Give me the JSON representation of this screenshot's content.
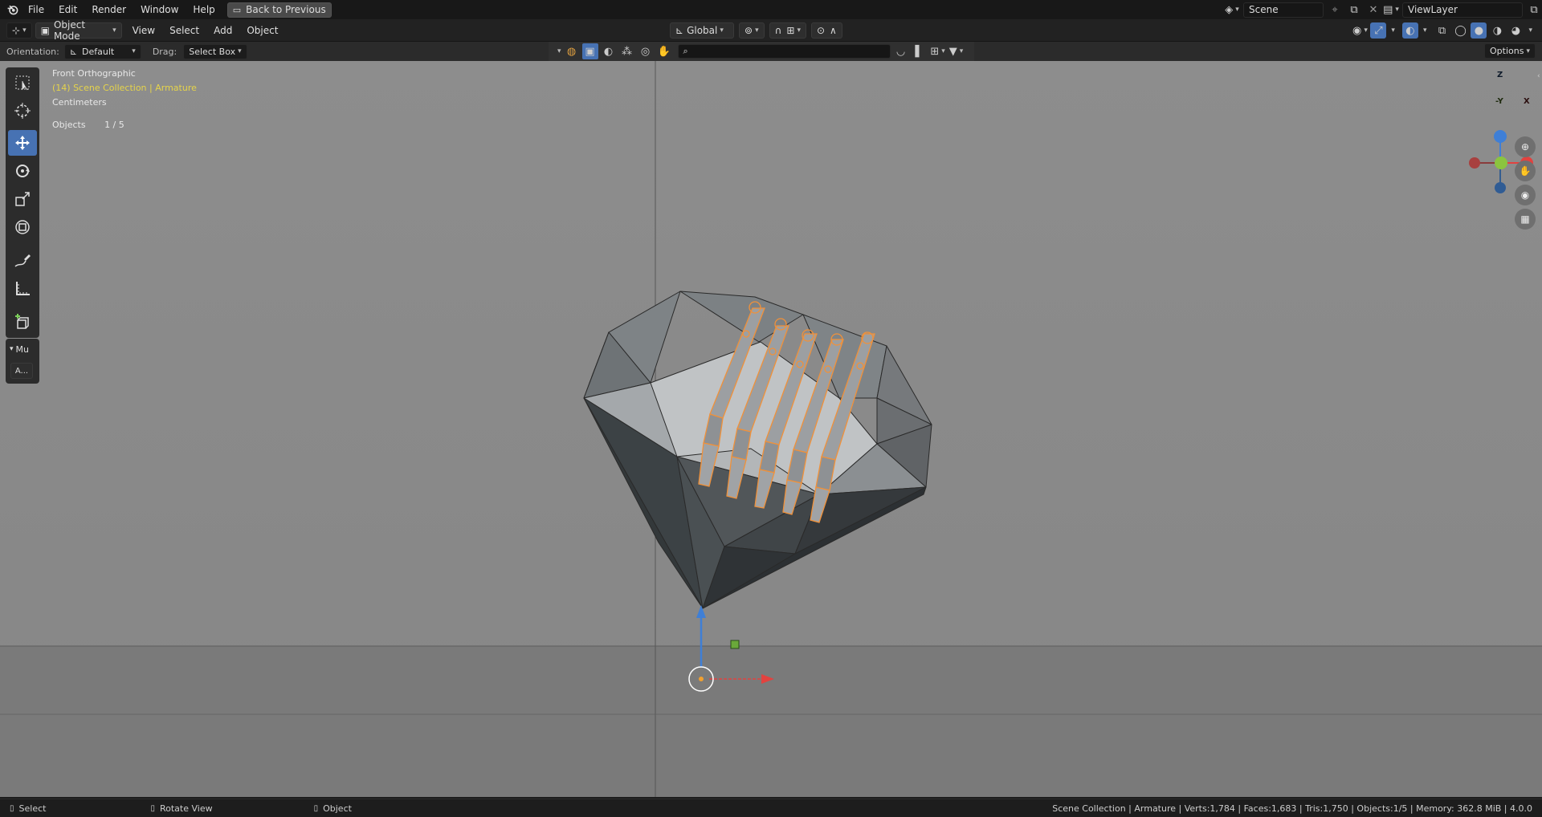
{
  "topbar": {
    "menus": [
      "File",
      "Edit",
      "Render",
      "Window",
      "Help"
    ],
    "back_label": "Back to Previous",
    "scene_name": "Scene",
    "view_layer": "ViewLayer"
  },
  "header": {
    "mode": "Object Mode",
    "menus": [
      "View",
      "Select",
      "Add",
      "Object"
    ],
    "transform_orientation": "Global"
  },
  "tool_settings": {
    "orientation_label": "Orientation:",
    "orientation_value": "Default",
    "drag_label": "Drag:",
    "drag_value": "Select Box",
    "options_label": "Options",
    "search_placeholder": ""
  },
  "viewport": {
    "view_name": "Front Orthographic",
    "collection_path": "(14) Scene Collection | Armature",
    "units": "Centimeters",
    "objects_label": "Objects",
    "objects_value": "1 / 5",
    "tool_panel_title": "Mu",
    "tool_panel_btn": "A...",
    "gizmo_axes": {
      "z": "Z",
      "y": "-Y",
      "x": "X"
    },
    "colors": {
      "x_axis": "#e2423f",
      "y_axis": "#8bc43f",
      "z_axis": "#3f7fd6",
      "selection": "#f0913a",
      "active_tool": "#4772b3"
    }
  },
  "status": {
    "left": [
      {
        "icon": "mouse-left-icon",
        "label": "Select"
      },
      {
        "icon": "mouse-middle-icon",
        "label": "Rotate View"
      },
      {
        "icon": "mouse-right-icon",
        "label": "Object"
      }
    ],
    "stats": "Scene Collection | Armature | Verts:1,784 | Faces:1,683 | Tris:1,750 | Objects:1/5 | Memory: 362.8 MiB | 4.0.0"
  }
}
